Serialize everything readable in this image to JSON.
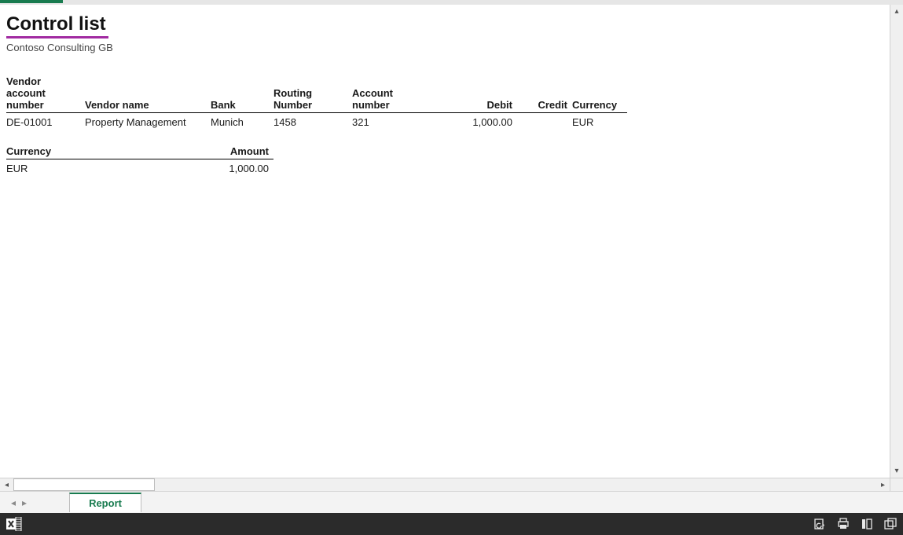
{
  "report": {
    "title": "Control list",
    "company": "Contoso Consulting GB"
  },
  "main_table": {
    "headers": {
      "vendor_account": "Vendor\naccount\nnumber",
      "vendor_name": "Vendor name",
      "bank": "Bank",
      "routing": "Routing\nNumber",
      "account_number": "Account\nnumber",
      "debit": "Debit",
      "credit": "Credit",
      "currency": "Currency"
    },
    "rows": [
      {
        "vendor_account": "DE-01001",
        "vendor_name": "Property Management",
        "bank": "Munich",
        "routing": "1458",
        "account_number": "321",
        "debit": "1,000.00",
        "credit": "",
        "currency": "EUR"
      }
    ]
  },
  "summary_table": {
    "headers": {
      "currency": "Currency",
      "amount": "Amount"
    },
    "rows": [
      {
        "currency": "EUR",
        "amount": "1,000.00"
      }
    ]
  },
  "tabs": {
    "report": "Report"
  }
}
